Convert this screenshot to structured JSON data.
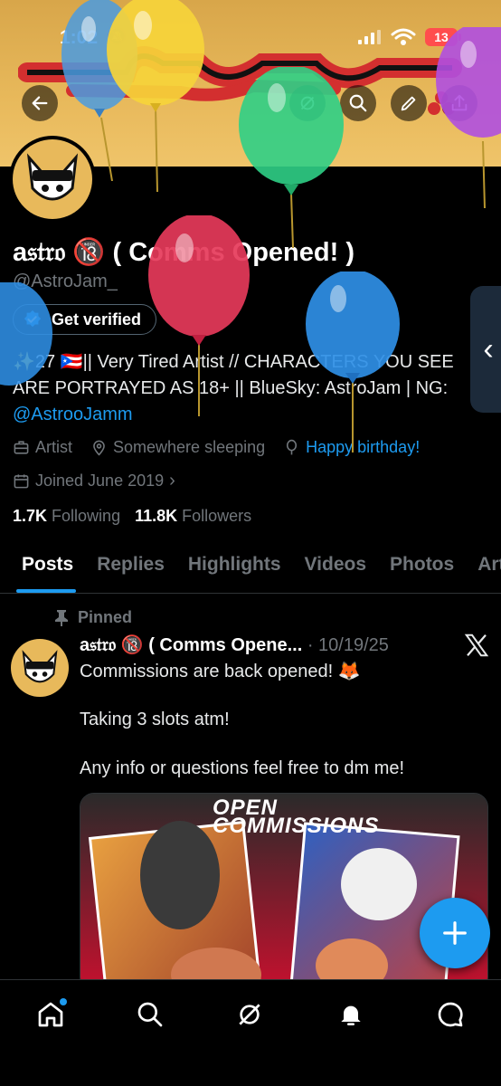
{
  "status_bar": {
    "time": "1:02",
    "battery": "13"
  },
  "profile": {
    "display_name": "a𝔰𝔱𝔯𝔬 🔞 ( Comms Opened! )",
    "handle": "@AstroJam_",
    "verify_label": "Get verified",
    "bio_line": "✨27 🇵🇷|| Very Tired Artist // CHARACTERS YOU SEE ARE PORTRAYED AS 18+ || BlueSky: AstroJam | NG: ",
    "bio_link": "@AstrooJamm",
    "category": "Artist",
    "location": "Somewhere sleeping",
    "birthday": "Happy birthday!",
    "joined": "Joined June 2019",
    "following_count": "1.7K",
    "following_label": "Following",
    "followers_count": "11.8K",
    "followers_label": "Followers"
  },
  "tabs": [
    "Posts",
    "Replies",
    "Highlights",
    "Videos",
    "Photos",
    "Articles"
  ],
  "post": {
    "pinned_label": "Pinned",
    "author": "a𝔰𝔱𝔯𝔬 🔞 ( Comms Opene...",
    "date": "· 10/19/25",
    "line1": "Commissions are back opened! 🦊",
    "line2": "Taking 3 slots atm!",
    "line3": "Any info or questions feel free to dm me!",
    "media_title_1": "OPEN",
    "media_title_2": "COMMISSIONS"
  },
  "colors": {
    "accent": "#1d9bf0",
    "banner": "#e8b95b",
    "muted": "#71767b"
  },
  "icons": [
    "back-arrow-icon",
    "grok-icon",
    "search-icon",
    "edit-icon",
    "share-icon",
    "verified-badge-icon",
    "briefcase-icon",
    "location-icon",
    "balloon-icon",
    "calendar-icon",
    "pin-icon",
    "x-logo-icon",
    "plus-icon",
    "home-icon",
    "search-icon",
    "grok-icon",
    "bell-icon",
    "message-icon"
  ]
}
